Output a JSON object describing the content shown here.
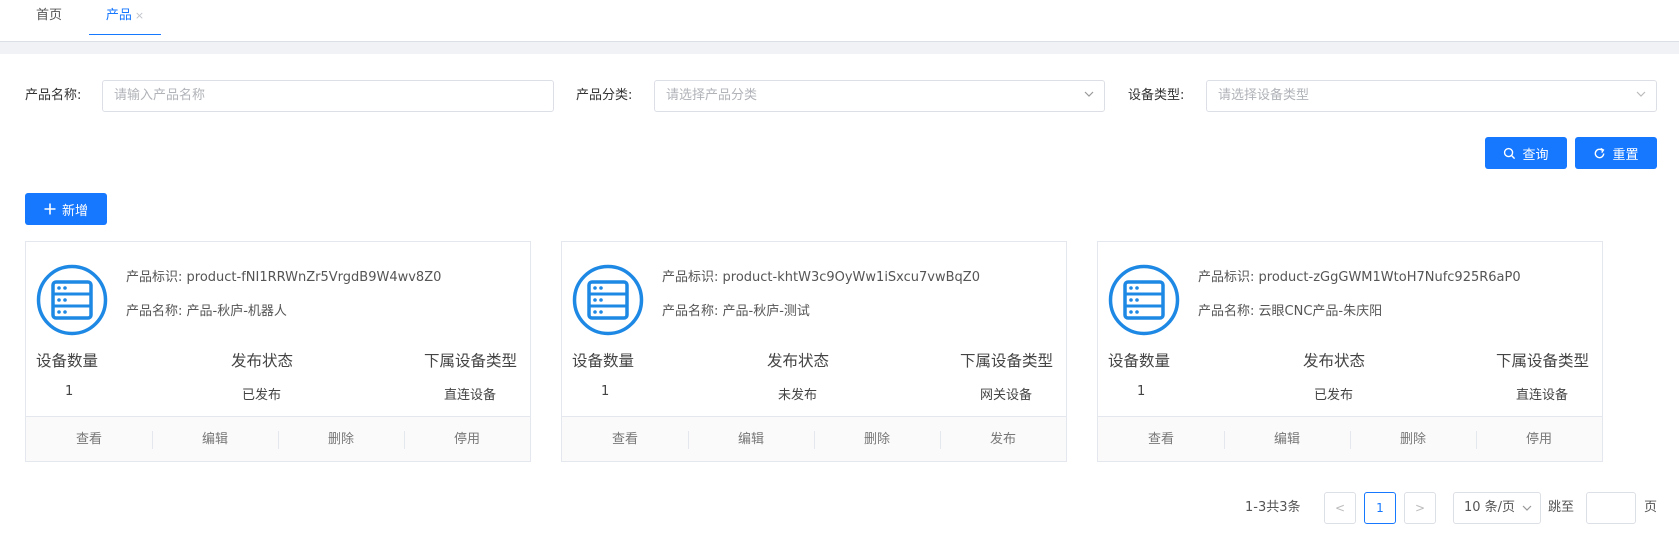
{
  "tabs": [
    {
      "label": "首页"
    },
    {
      "label": "产品",
      "close": "×"
    }
  ],
  "filters": {
    "product_name": {
      "label": "产品名称:",
      "placeholder": "请输入产品名称"
    },
    "category": {
      "label": "产品分类:",
      "placeholder": "请选择产品分类"
    },
    "device_type": {
      "label": "设备类型:",
      "placeholder": "请选择设备类型"
    }
  },
  "buttons": {
    "search": "查询",
    "reset": "重置",
    "add": "新增"
  },
  "card_labels": {
    "id_label": "产品标识:",
    "name_label": "产品名称:",
    "device_count": "设备数量",
    "publish_status": "发布状态",
    "sub_device_type": "下属设备类型"
  },
  "products": [
    {
      "id": "product-fNI1RRWnZr5VrgdB9W4wv8Z0",
      "name": "产品-秋庐-机器人",
      "device_count": "1",
      "status": "已发布",
      "device_type": "直连设备",
      "actions": [
        "查看",
        "编辑",
        "删除",
        "停用"
      ]
    },
    {
      "id": "product-khtW3c9OyWw1iSxcu7vwBqZ0",
      "name": "产品-秋庐-测试",
      "device_count": "1",
      "status": "未发布",
      "device_type": "网关设备",
      "actions": [
        "查看",
        "编辑",
        "删除",
        "发布"
      ]
    },
    {
      "id": "product-zGgGWM1WtoH7Nufc925R6aP0",
      "name": "云眼CNC产品-朱庆阳",
      "device_count": "1",
      "status": "已发布",
      "device_type": "直连设备",
      "actions": [
        "查看",
        "编辑",
        "删除",
        "停用"
      ]
    }
  ],
  "pagination": {
    "total_text": "1-3共3条",
    "prev": "<",
    "current_page": "1",
    "next": ">",
    "page_size": "10 条/页",
    "jump_label": "跳至",
    "page_suffix": "页"
  },
  "colors": {
    "primary": "#1677ff",
    "icon": "#1e88e5"
  }
}
